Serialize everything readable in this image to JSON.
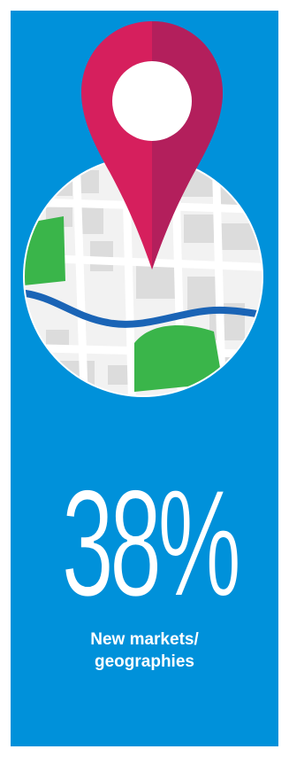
{
  "stat": {
    "value": "38%"
  },
  "caption": {
    "line1": "New markets/",
    "line2": "geographies"
  },
  "illustration": {
    "icons": [
      "map-circle",
      "location-pin-icon",
      "river-line"
    ]
  },
  "colors": {
    "background": "#0091da",
    "pin": "#d61f5d",
    "pin_shadow": "#b31f5c",
    "map_base": "#f2f2f2",
    "map_blocks": "#dcdcdc",
    "park": "#3ab54a",
    "river": "#1a64b6",
    "text": "#ffffff"
  }
}
